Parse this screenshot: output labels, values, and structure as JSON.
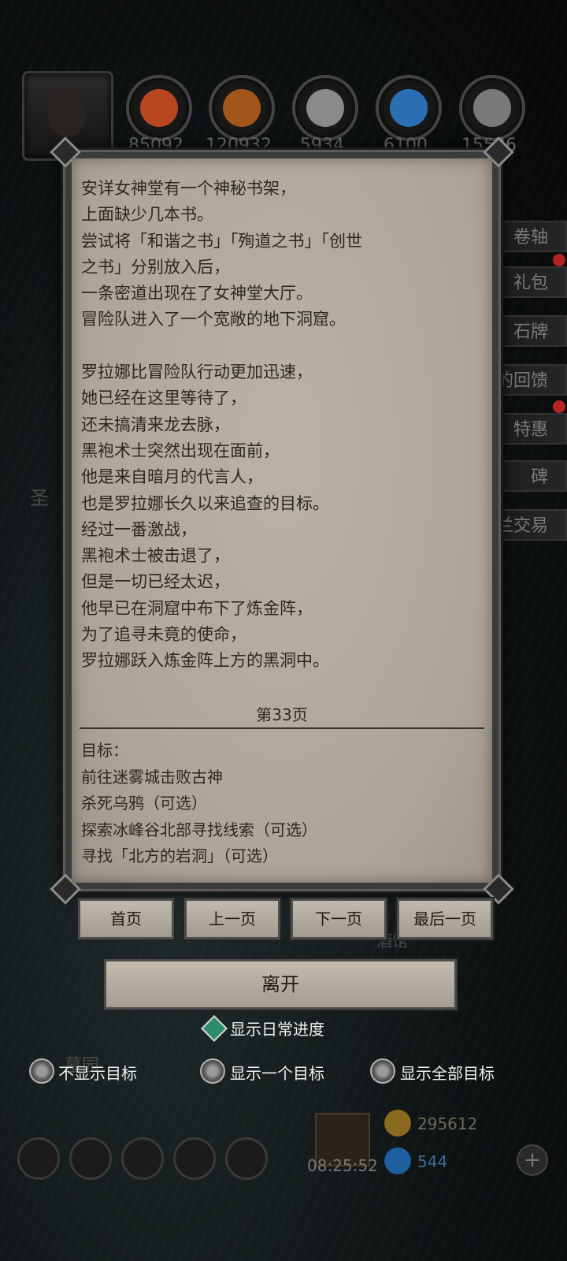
{
  "resources": [
    {
      "icon": "ore-icon",
      "value": "85092",
      "color": "#b5461e"
    },
    {
      "icon": "wood-icon",
      "value": "120932",
      "color": "#a3561c"
    },
    {
      "icon": "iron-icon",
      "value": "5934",
      "color": "#8a8a8a"
    },
    {
      "icon": "crystal-icon",
      "value": "6100",
      "color": "#2a6fb3"
    },
    {
      "icon": "steel-icon",
      "value": "15536",
      "color": "#7a7a7a"
    }
  ],
  "side_menu": [
    "卷轴",
    "礼包",
    "石牌",
    "的回馈",
    "特惠",
    "碑",
    "兰交易"
  ],
  "background_text": {
    "left": "圣",
    "right": "酒馆",
    "tomb": "墓园",
    "gold": "295612",
    "gems": "544",
    "time": "08:25:52"
  },
  "story_text": "安详女神堂有一个神秘书架，\n上面缺少几本书。\n尝试将「和谐之书」「殉道之书」「创世\n之书」分别放入后，\n一条密道出现在了女神堂大厅。\n冒险队进入了一个宽敞的地下洞窟。\n\n罗拉娜比冒险队行动更加迅速，\n她已经在这里等待了，\n还未搞清来龙去脉，\n黑袍术士突然出现在面前，\n他是来自暗月的代言人，\n也是罗拉娜长久以来追查的目标。\n经过一番激战，\n黑袍术士被击退了，\n但是一切已经太迟，\n他早已在洞窟中布下了炼金阵，\n为了追寻未竟的使命，\n罗拉娜跃入炼金阵上方的黑洞中。",
  "page_label": "第33页",
  "goals_title": "目标：",
  "goals": [
    "前往迷雾城击败古神",
    "杀死乌鸦（可选）",
    "探索冰峰谷北部寻找线索（可选）",
    "寻找「北方的岩洞」（可选）"
  ],
  "nav": {
    "first": "首页",
    "prev": "上一页",
    "next": "下一页",
    "last": "最后一页"
  },
  "leave": "离开",
  "daily_progress": "显示日常进度",
  "radios": [
    "不显示目标",
    "显示一个目标",
    "显示全部目标"
  ]
}
